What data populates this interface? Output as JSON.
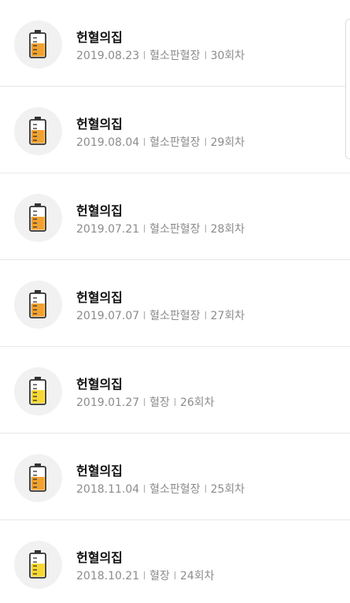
{
  "records": [
    {
      "title": "헌혈의집",
      "date": "2019.08.23",
      "type": "혈소판혈장",
      "count": "30회차",
      "fill_color": "#f2a12e"
    },
    {
      "title": "헌혈의집",
      "date": "2019.08.04",
      "type": "혈소판혈장",
      "count": "29회차",
      "fill_color": "#f2a12e"
    },
    {
      "title": "헌혈의집",
      "date": "2019.07.21",
      "type": "혈소판혈장",
      "count": "28회차",
      "fill_color": "#f2a12e"
    },
    {
      "title": "헌혈의집",
      "date": "2019.07.07",
      "type": "혈소판혈장",
      "count": "27회차",
      "fill_color": "#f2a12e"
    },
    {
      "title": "헌혈의집",
      "date": "2019.01.27",
      "type": "혈장",
      "count": "26회차",
      "fill_color": "#f7d731"
    },
    {
      "title": "헌혈의집",
      "date": "2018.11.04",
      "type": "혈소판혈장",
      "count": "25회차",
      "fill_color": "#f2a12e"
    },
    {
      "title": "헌혈의집",
      "date": "2018.10.21",
      "type": "혈장",
      "count": "24회차",
      "fill_color": "#f7d731"
    }
  ]
}
